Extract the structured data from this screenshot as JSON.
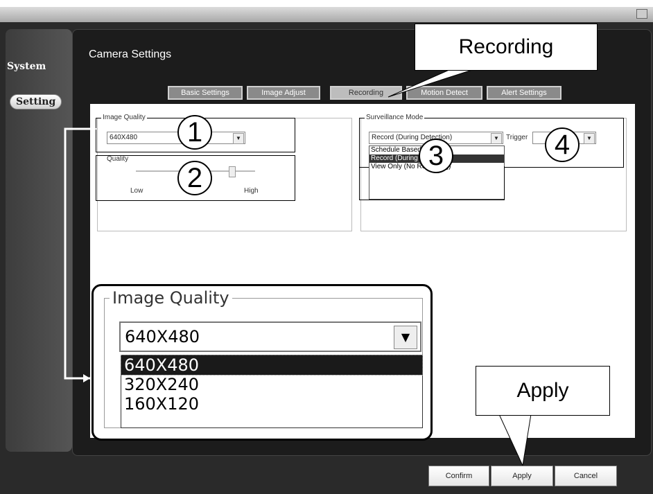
{
  "sidebar": {
    "system": "System",
    "setting": "Setting"
  },
  "page_title": "Camera Settings",
  "tabs": [
    "Basic Settings",
    "Image Adjust",
    "Recording",
    "Motion Detect",
    "Alert Settings"
  ],
  "image_quality": {
    "legend": "Image Quality",
    "value": "640X480"
  },
  "quality": {
    "legend": "Quality",
    "low": "Low",
    "high": "High"
  },
  "surveillance": {
    "legend": "Surveillance Mode",
    "value": "Record (During Detection)",
    "options": [
      "Schedule Based",
      "Record (During Detection)",
      "View Only (No Recording)"
    ],
    "trigger_label": "Trigger"
  },
  "markers": [
    "1",
    "2",
    "3",
    "4"
  ],
  "callouts": {
    "recording": "Recording",
    "apply": "Apply"
  },
  "zoom": {
    "legend": "Image Quality",
    "value": "640X480",
    "options": [
      "640X480",
      "320X240",
      "160X120"
    ],
    "selected_index": 0
  },
  "buttons": {
    "confirm": "Confirm",
    "apply": "Apply",
    "cancel": "Cancel"
  },
  "colors": {
    "selection": "#1a1a1a",
    "frame": "#2a2a2a",
    "tab": "#8a8a8a"
  }
}
